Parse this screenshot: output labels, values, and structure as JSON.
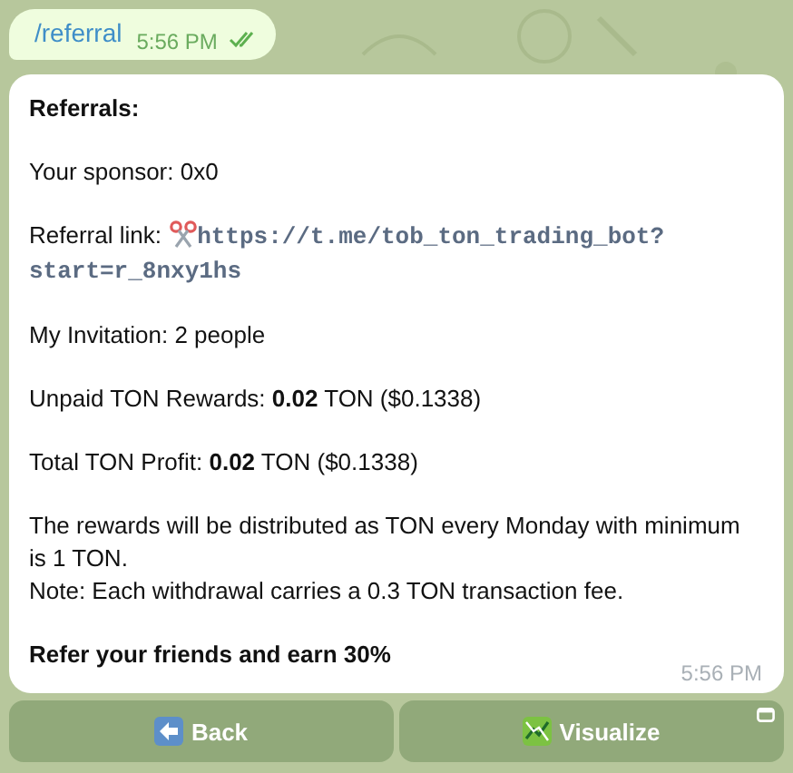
{
  "outgoing": {
    "text": "/referral",
    "time": "5:56 PM",
    "read": true
  },
  "message": {
    "paragraphs": [
      {
        "kind": "heading",
        "lines": [
          "Referrals:"
        ]
      },
      {
        "kind": "text",
        "lines": [
          "Your sponsor: 0x0"
        ]
      },
      {
        "kind": "link",
        "label": "Referral link: ",
        "url_lines": [
          "https://t.me/tob_ton_trading_bot?",
          "start=r_8nxy1hs"
        ]
      },
      {
        "kind": "text",
        "lines": [
          "My Invitation: 2 people"
        ]
      },
      {
        "kind": "text",
        "lines": [
          "Unpaid TON Rewards: **0.02** TON ($0.1338)"
        ]
      },
      {
        "kind": "text",
        "lines": [
          "Total TON Profit: **0.02** TON ($0.1338)"
        ]
      },
      {
        "kind": "text",
        "lines": [
          "The rewards will be distributed as TON every Monday with minimum is 1 TON.",
          "Note: Each withdrawal carries a 0.3 TON transaction fee."
        ]
      },
      {
        "kind": "heading",
        "lines": [
          "Refer your friends and earn 30%"
        ]
      }
    ],
    "time": "5:56 PM"
  },
  "buttons": [
    {
      "label": "Back",
      "kind": "back",
      "web_app": false
    },
    {
      "label": "Visualize",
      "kind": "chart",
      "web_app": true
    }
  ]
}
